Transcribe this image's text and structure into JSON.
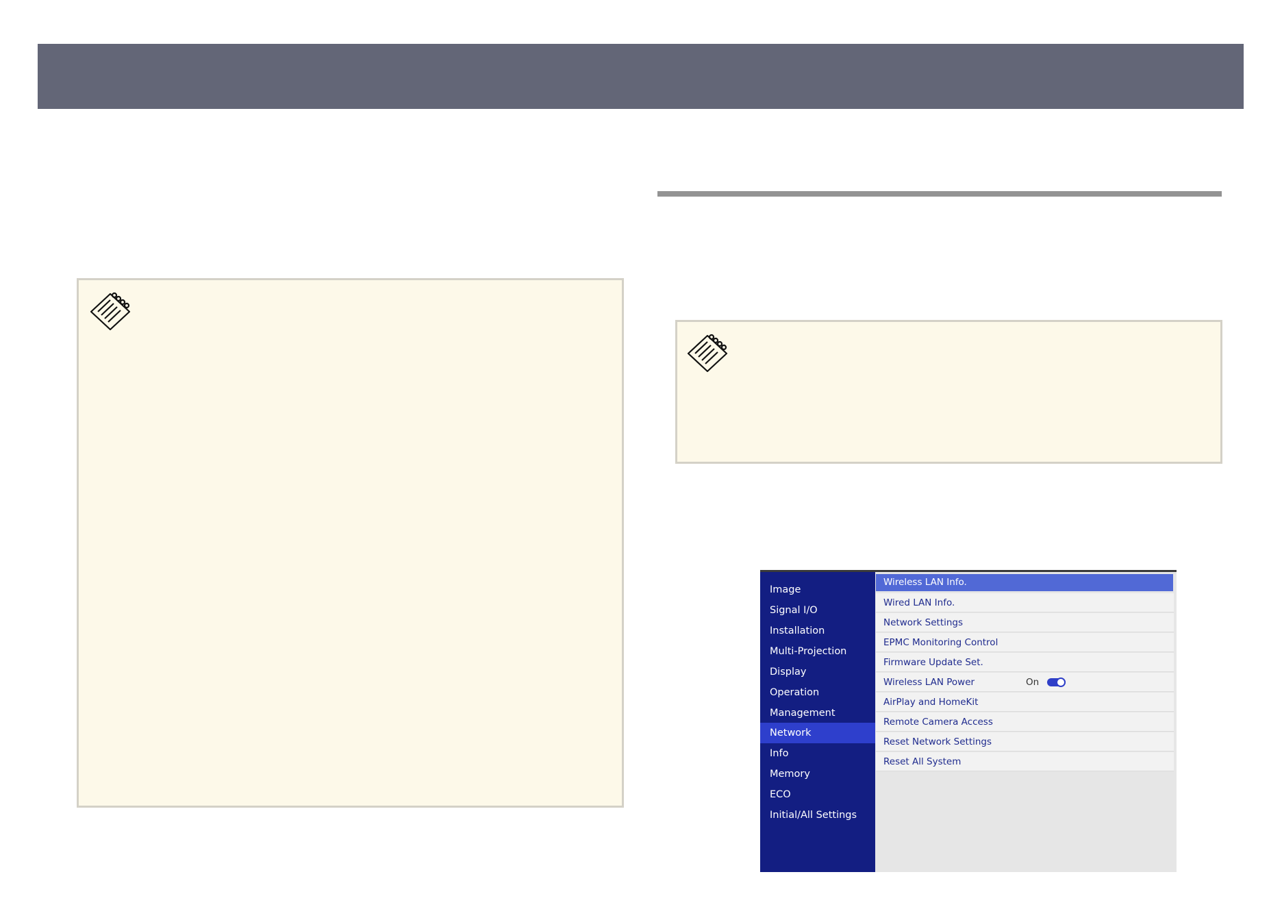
{
  "header": {
    "color": "#636677"
  },
  "notes": [
    {
      "icon": "note-pad-icon"
    },
    {
      "icon": "note-pad-icon"
    }
  ],
  "menu": {
    "side_items": [
      {
        "label": "Image"
      },
      {
        "label": "Signal I/O"
      },
      {
        "label": "Installation"
      },
      {
        "label": "Multi-Projection"
      },
      {
        "label": "Display"
      },
      {
        "label": "Operation"
      },
      {
        "label": "Management"
      },
      {
        "label": "Network"
      },
      {
        "label": "Info"
      },
      {
        "label": "Memory"
      },
      {
        "label": "ECO"
      },
      {
        "label": "Initial/All Settings"
      }
    ],
    "active_side": "Network",
    "right_items": [
      {
        "label": "Wireless LAN Info."
      },
      {
        "label": "Wired LAN Info."
      },
      {
        "label": "Network Settings"
      },
      {
        "label": "EPMC Monitoring Control"
      },
      {
        "label": "Firmware Update Set."
      },
      {
        "label": "Wireless LAN Power",
        "value": "On"
      },
      {
        "label": "AirPlay and HomeKit"
      },
      {
        "label": "Remote Camera Access"
      },
      {
        "label": "Reset Network Settings"
      },
      {
        "label": "Reset All System"
      }
    ],
    "selected_right": "Wireless LAN Info.",
    "wireless_toggle_on": true,
    "colors": {
      "sidebar": "#131e82",
      "sidebar_active": "#2e3fcc",
      "selected_item": "#5169d6",
      "item_text": "#1f2b8e"
    }
  }
}
